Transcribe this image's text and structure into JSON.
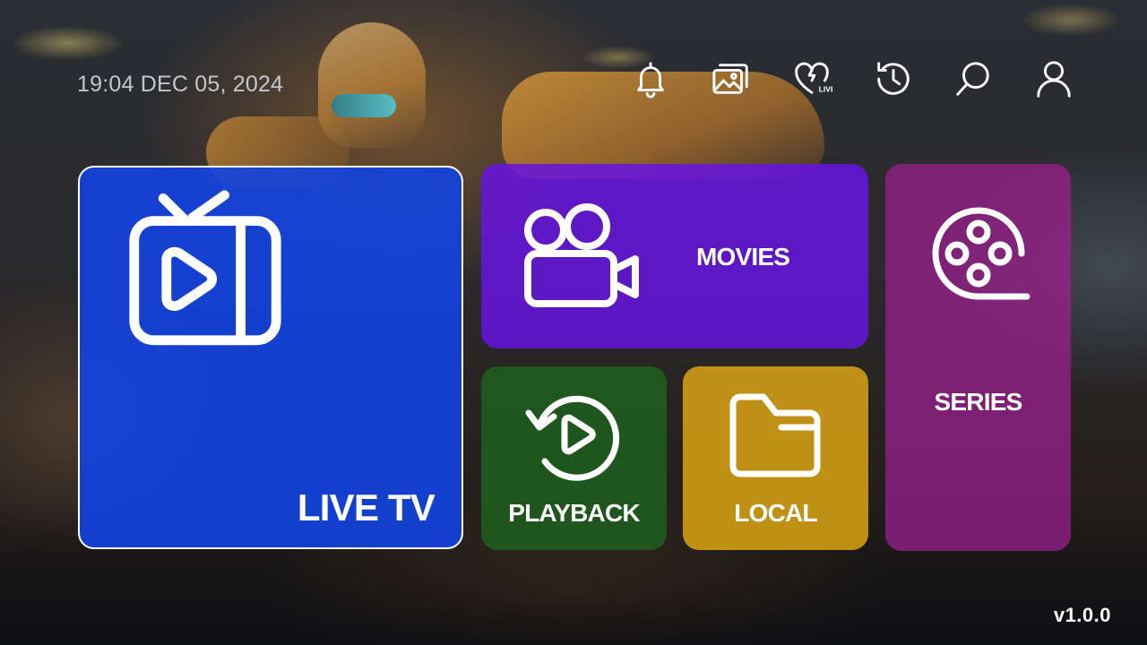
{
  "header": {
    "datetime": "19:04 DEC 05, 2024",
    "nav": [
      {
        "id": "notifications",
        "icon": "bell-icon"
      },
      {
        "id": "gallery",
        "icon": "images-icon"
      },
      {
        "id": "favorites-live",
        "icon": "heart-live-icon",
        "badge": "LIVE"
      },
      {
        "id": "history",
        "icon": "history-icon"
      },
      {
        "id": "search",
        "icon": "search-icon"
      },
      {
        "id": "profile",
        "icon": "user-icon"
      }
    ]
  },
  "tiles": {
    "live_tv": {
      "label": "LIVE TV",
      "icon": "tv-play-icon",
      "color": "#1244e1"
    },
    "movies": {
      "label": "MOVIES",
      "icon": "movie-camera-icon",
      "color": "#6614e1"
    },
    "series": {
      "label": "SERIES",
      "icon": "film-reel-icon",
      "color": "#a01e91"
    },
    "playback": {
      "label": "PLAYBACK",
      "icon": "replay-icon",
      "color": "#1e641e"
    },
    "local": {
      "label": "LOCAL",
      "icon": "folder-icon",
      "color": "#dca514"
    }
  },
  "footer": {
    "version": "v1.0.0"
  }
}
